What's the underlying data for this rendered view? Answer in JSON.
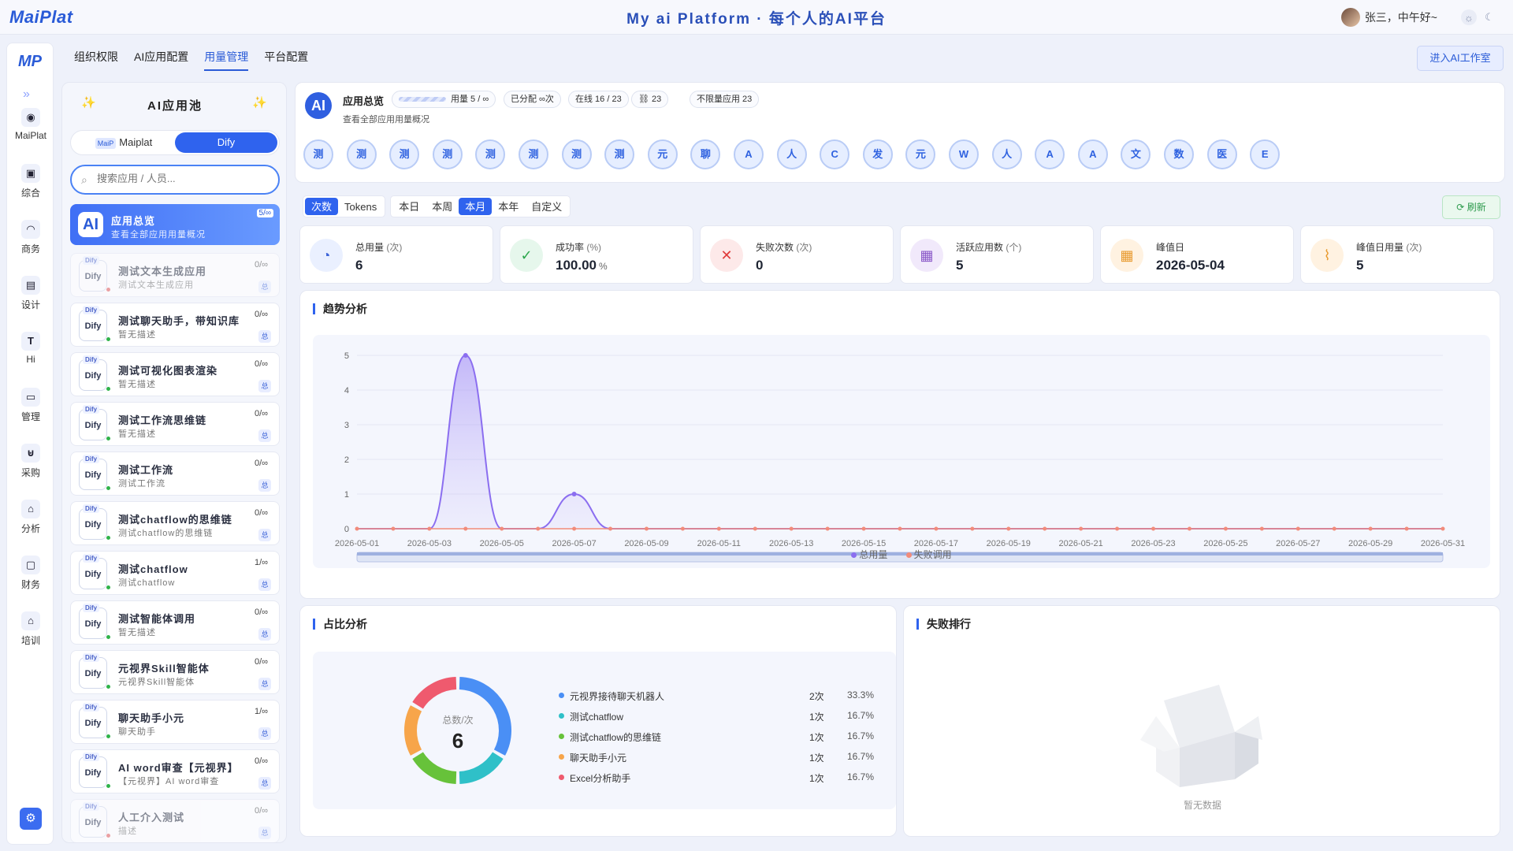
{
  "header": {
    "logo": "MaiPlat",
    "brand": "My ai Platform  ·  每个人的AI平台",
    "user": "张三，中午好~"
  },
  "nav": {
    "logo": "MP",
    "items": [
      {
        "label": "MaiPlat",
        "icon": "robot-icon",
        "glyph": "◉"
      },
      {
        "label": "综合",
        "icon": "save-icon",
        "glyph": "▣"
      },
      {
        "label": "商务",
        "icon": "headset-icon",
        "glyph": "◠"
      },
      {
        "label": "设计",
        "icon": "document-icon",
        "glyph": "▤"
      },
      {
        "label": "Hi",
        "icon": "text-icon",
        "glyph": "T"
      },
      {
        "label": "管理",
        "icon": "archive-icon",
        "glyph": "▭"
      },
      {
        "label": "采购",
        "icon": "cart-icon",
        "glyph": "⊌"
      },
      {
        "label": "分析",
        "icon": "home-icon",
        "glyph": "⌂"
      },
      {
        "label": "财务",
        "icon": "lock-icon",
        "glyph": "▢"
      },
      {
        "label": "培训",
        "icon": "home-icon",
        "glyph": "⌂"
      }
    ]
  },
  "tabs": [
    {
      "label": "组织权限"
    },
    {
      "label": "AI应用配置"
    },
    {
      "label": "用量管理",
      "active": true
    },
    {
      "label": "平台配置"
    }
  ],
  "enter_button": "进入AI工作室",
  "pool": {
    "title": "AI应用池",
    "seg_left_tag": "MaiP",
    "seg_left": "Maiplat",
    "seg_right": "Dify",
    "search_placeholder": "搜索应用 / 人员...",
    "overview": {
      "title": "应用总览",
      "sub": "查看全部应用用量概况",
      "badge": "5/∞"
    },
    "apps": [
      {
        "name": "测试文本生成应用",
        "desc": "测试文本生成应用",
        "usage": "0/∞",
        "status": "red",
        "dim": true
      },
      {
        "name": "测试聊天助手，带知识库",
        "desc": "暂无描述",
        "usage": "0/∞",
        "status": "green"
      },
      {
        "name": "测试可视化图表渲染",
        "desc": "暂无描述",
        "usage": "0/∞",
        "status": "green"
      },
      {
        "name": "测试工作流思维链",
        "desc": "暂无描述",
        "usage": "0/∞",
        "status": "green"
      },
      {
        "name": "测试工作流",
        "desc": "测试工作流",
        "usage": "0/∞",
        "status": "green"
      },
      {
        "name": "测试chatflow的思维链",
        "desc": "测试chatflow的思维链",
        "usage": "0/∞",
        "status": "green"
      },
      {
        "name": "测试chatflow",
        "desc": "测试chatflow",
        "usage": "1/∞",
        "status": "green"
      },
      {
        "name": "测试智能体调用",
        "desc": "暂无描述",
        "usage": "0/∞",
        "status": "green"
      },
      {
        "name": "元视界Skill智能体",
        "desc": "元视界Skill智能体",
        "usage": "0/∞",
        "status": "green"
      },
      {
        "name": "聊天助手小元",
        "desc": "聊天助手",
        "usage": "1/∞",
        "status": "green"
      },
      {
        "name": "AI word审查【元视界】",
        "desc": "【元视界】AI word审查",
        "usage": "0/∞",
        "status": "green"
      },
      {
        "name": "人工介入测试",
        "desc": "描述",
        "usage": "0/∞",
        "status": "red",
        "dim": true
      }
    ]
  },
  "overview": {
    "title": "应用总览",
    "sub": "查看全部应用用量概况",
    "pills": [
      "用量 5 / ∞",
      "已分配 ∞次",
      "在线 16 / 23",
      "⛓ 23",
      "不限量应用 23"
    ],
    "circles": [
      "测",
      "测",
      "测",
      "测",
      "测",
      "测",
      "测",
      "测",
      "元",
      "聊",
      "A",
      "人",
      "C",
      "发",
      "元",
      "W",
      "人",
      "A",
      "A",
      "文",
      "数",
      "医",
      "E"
    ]
  },
  "filters": {
    "metric": [
      "次数",
      "Tokens"
    ],
    "metric_active": 0,
    "range": [
      "本日",
      "本周",
      "本月",
      "本年",
      "自定义"
    ],
    "range_active": 2,
    "refresh": "刷新"
  },
  "stats": [
    {
      "label": "总用量",
      "unit_label": "(次)",
      "value": "6",
      "icon": "gauge-icon",
      "glyph": "◔",
      "bg": "#eaf0ff",
      "fg": "#3a62d8"
    },
    {
      "label": "成功率",
      "unit_label": "(%)",
      "value": "100.00",
      "suffix": "%",
      "icon": "check-circle-icon",
      "glyph": "✓",
      "bg": "#e6f7ec",
      "fg": "#2ba74c"
    },
    {
      "label": "失败次数",
      "unit_label": "(次)",
      "value": "0",
      "icon": "error-icon",
      "glyph": "✕",
      "bg": "#fde9e9",
      "fg": "#e03a3a"
    },
    {
      "label": "活跃应用数",
      "unit_label": "(个)",
      "value": "5",
      "icon": "building-icon",
      "glyph": "▦",
      "bg": "#f1e9fb",
      "fg": "#8a58c8"
    },
    {
      "label": "峰值日",
      "unit_label": "",
      "value": "2026-05-04",
      "icon": "calendar-icon",
      "glyph": "▦",
      "bg": "#fff2e1",
      "fg": "#e89a2e"
    },
    {
      "label": "峰值日用量",
      "unit_label": "(次)",
      "value": "5",
      "icon": "chart-icon",
      "glyph": "⌇",
      "bg": "#fff2e1",
      "fg": "#e89a2e"
    }
  ],
  "trend": {
    "title": "趋势分析"
  },
  "share": {
    "title": "占比分析",
    "center_label": "总数/次",
    "center_value": "6"
  },
  "fail": {
    "title": "失败排行",
    "empty": "暂无数据"
  },
  "chart_data": [
    {
      "type": "line",
      "title": "趋势分析",
      "xlabel": "",
      "ylabel": "",
      "ylim": [
        0,
        5
      ],
      "x": [
        "2026-05-01",
        "2026-05-02",
        "2026-05-03",
        "2026-05-04",
        "2026-05-05",
        "2026-05-06",
        "2026-05-07",
        "2026-05-08",
        "2026-05-09",
        "2026-05-10",
        "2026-05-11",
        "2026-05-12",
        "2026-05-13",
        "2026-05-14",
        "2026-05-15",
        "2026-05-16",
        "2026-05-17",
        "2026-05-18",
        "2026-05-19",
        "2026-05-20",
        "2026-05-21",
        "2026-05-22",
        "2026-05-23",
        "2026-05-24",
        "2026-05-25",
        "2026-05-26",
        "2026-05-27",
        "2026-05-28",
        "2026-05-29",
        "2026-05-30",
        "2026-05-31"
      ],
      "xticks": [
        "2026-05-01",
        "2026-05-03",
        "2026-05-05",
        "2026-05-07",
        "2026-05-09",
        "2026-05-11",
        "2026-05-13",
        "2026-05-15",
        "2026-05-17",
        "2026-05-19",
        "2026-05-21",
        "2026-05-23",
        "2026-05-25",
        "2026-05-27",
        "2026-05-29",
        "2026-05-31"
      ],
      "yticks": [
        0,
        1,
        2,
        3,
        4,
        5
      ],
      "series": [
        {
          "name": "总用量",
          "color": "#8b6ef0",
          "values": [
            0,
            0,
            0,
            5,
            0,
            0,
            1,
            0,
            0,
            0,
            0,
            0,
            0,
            0,
            0,
            0,
            0,
            0,
            0,
            0,
            0,
            0,
            0,
            0,
            0,
            0,
            0,
            0,
            0,
            0,
            0
          ]
        },
        {
          "name": "失败调用",
          "color": "#f28b7a",
          "values": [
            0,
            0,
            0,
            0,
            0,
            0,
            0,
            0,
            0,
            0,
            0,
            0,
            0,
            0,
            0,
            0,
            0,
            0,
            0,
            0,
            0,
            0,
            0,
            0,
            0,
            0,
            0,
            0,
            0,
            0,
            0
          ]
        }
      ]
    },
    {
      "type": "pie",
      "title": "占比分析",
      "categories": [
        "元视界接待聊天机器人",
        "测试chatflow",
        "测试chatflow的思维链",
        "聊天助手小元",
        "Excel分析助手"
      ],
      "values": [
        2,
        1,
        1,
        1,
        1
      ],
      "counts": [
        "2次",
        "1次",
        "1次",
        "1次",
        "1次"
      ],
      "percents": [
        "33.3%",
        "16.7%",
        "16.7%",
        "16.7%",
        "16.7%"
      ],
      "colors": [
        "#4a8ff5",
        "#2fc0c8",
        "#67c23a",
        "#f7a54a",
        "#ef5a6e"
      ]
    }
  ]
}
